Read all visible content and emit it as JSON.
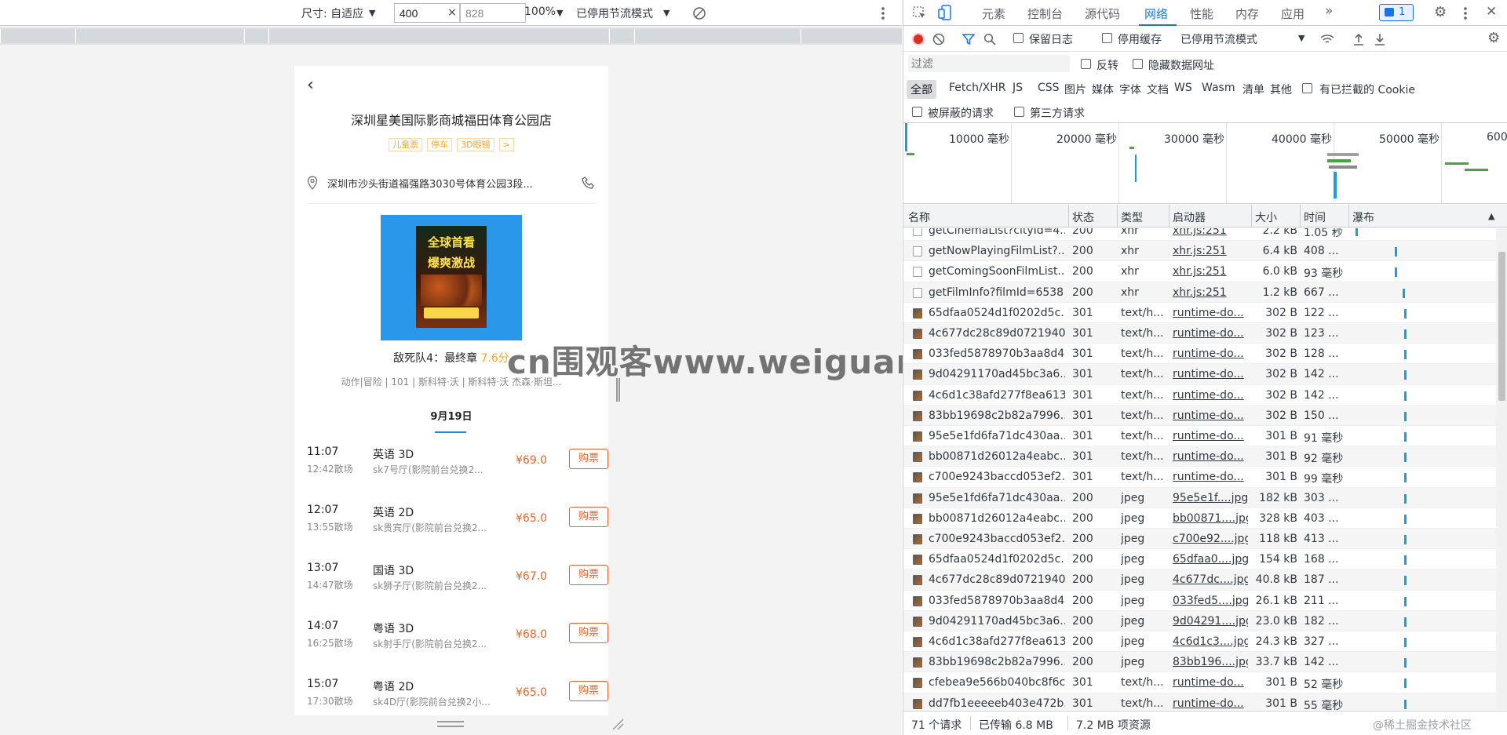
{
  "emulation": {
    "size_label": "尺寸: 自适应",
    "width": "400",
    "height": "828",
    "times": "×",
    "zoom": "100%",
    "throttle": "已停用节流模式"
  },
  "mobile": {
    "cinema_name": "深圳星美国际影商城福田体育公园店",
    "tags": [
      "儿童票",
      "停车",
      "3D眼镜",
      ">"
    ],
    "address": "深圳市沙头街道福强路3030号体育公园3段...",
    "poster_line1": "全球首看",
    "poster_line2": "爆爽激战",
    "film_title": "敌死队4：最终章",
    "film_score": "7.6分",
    "film_info": "动作|冒险 | 101 | 斯科特·沃 | 斯科特·沃 杰森·斯坦...",
    "date_tab": "9月19日",
    "shows": [
      {
        "start": "11:07",
        "end": "12:42散场",
        "lang": "英语 3D",
        "hall": "sk7号厅(影院前台兑换2...",
        "price": "¥69.0",
        "buy": "购票"
      },
      {
        "start": "12:07",
        "end": "13:55散场",
        "lang": "英语 2D",
        "hall": "sk贵宾厅(影院前台兑换2...",
        "price": "¥65.0",
        "buy": "购票"
      },
      {
        "start": "13:07",
        "end": "14:47散场",
        "lang": "国语 3D",
        "hall": "sk狮子厅(影院前台兑换2...",
        "price": "¥67.0",
        "buy": "购票"
      },
      {
        "start": "14:07",
        "end": "16:25散场",
        "lang": "粤语 3D",
        "hall": "sk射手厅(影院前台兑换2...",
        "price": "¥68.0",
        "buy": "购票"
      },
      {
        "start": "15:07",
        "end": "17:30散场",
        "lang": "粤语 2D",
        "hall": "sk4D厅(影院前台兑换2小...",
        "price": "¥65.0",
        "buy": "购票"
      }
    ]
  },
  "watermark": "cn围观客www.weiguanke.cn",
  "devtools": {
    "tabs": [
      "元素",
      "控制台",
      "源代码",
      "网络",
      "性能",
      "内存",
      "应用"
    ],
    "active_tab": "网络",
    "more": "»",
    "issues_badge": "1",
    "toolbar": {
      "preserve_log": "保留日志",
      "disable_cache": "停用缓存",
      "throttle": "已停用节流模式"
    },
    "filter_placeholder": "过滤",
    "invert": "反转",
    "hide_data_urls": "隐藏数据网址",
    "types": [
      "全部",
      "Fetch/XHR",
      "JS",
      "CSS",
      "图片",
      "媒体",
      "字体",
      "文档",
      "WS",
      "Wasm",
      "清单",
      "其他"
    ],
    "blocked_cookies": "有已拦截的 Cookie",
    "blocked_requests": "被屏蔽的请求",
    "third_party": "第三方请求",
    "overview_ticks": [
      "10000 毫秒",
      "20000 毫秒",
      "30000 毫秒",
      "40000 毫秒",
      "50000 毫秒",
      "600"
    ],
    "columns": [
      "名称",
      "状态",
      "类型",
      "启动器",
      "大小",
      "时间",
      "瀑布"
    ],
    "rows": [
      {
        "name": "getCinemaList?cityId=4...",
        "status": "200",
        "type": "xhr",
        "init": "xhr.js:251",
        "size": "2.2 kB",
        "time": "1.05 秒",
        "img": false,
        "wf": 2
      },
      {
        "name": "getNowPlayingFilmList?...",
        "status": "200",
        "type": "xhr",
        "init": "xhr.js:251",
        "size": "6.4 kB",
        "time": "408 ...",
        "img": false,
        "wf": 27
      },
      {
        "name": "getComingSoonFilmList...",
        "status": "200",
        "type": "xhr",
        "init": "xhr.js:251",
        "size": "6.0 kB",
        "time": "93 毫秒",
        "img": false,
        "wf": 27
      },
      {
        "name": "getFilmInfo?filmId=6538",
        "status": "200",
        "type": "xhr",
        "init": "xhr.js:251",
        "size": "1.2 kB",
        "time": "667 ...",
        "img": false,
        "wf": 32
      },
      {
        "name": "65dfaa0524d1f0202d5c...",
        "status": "301",
        "type": "text/h...",
        "init": "runtime-do...",
        "size": "302 B",
        "time": "122 ...",
        "img": true,
        "wf": 33
      },
      {
        "name": "4c677dc28c89d0721940...",
        "status": "301",
        "type": "text/h...",
        "init": "runtime-do...",
        "size": "302 B",
        "time": "123 ...",
        "img": true,
        "wf": 33
      },
      {
        "name": "033fed5878970b3aa8d4...",
        "status": "301",
        "type": "text/h...",
        "init": "runtime-do...",
        "size": "302 B",
        "time": "128 ...",
        "img": true,
        "wf": 33
      },
      {
        "name": "9d04291170ad45bc3a6...",
        "status": "301",
        "type": "text/h...",
        "init": "runtime-do...",
        "size": "302 B",
        "time": "142 ...",
        "img": true,
        "wf": 33
      },
      {
        "name": "4c6d1c38afd277f8ea613...",
        "status": "301",
        "type": "text/h...",
        "init": "runtime-do...",
        "size": "302 B",
        "time": "142 ...",
        "img": true,
        "wf": 33
      },
      {
        "name": "83bb19698c2b82a7996...",
        "status": "301",
        "type": "text/h...",
        "init": "runtime-do...",
        "size": "302 B",
        "time": "150 ...",
        "img": true,
        "wf": 33
      },
      {
        "name": "95e5e1fd6fa71dc430aa...",
        "status": "301",
        "type": "text/h...",
        "init": "runtime-do...",
        "size": "301 B",
        "time": "91 毫秒",
        "img": true,
        "wf": 33
      },
      {
        "name": "bb00871d26012a4eabc...",
        "status": "301",
        "type": "text/h...",
        "init": "runtime-do...",
        "size": "301 B",
        "time": "92 毫秒",
        "img": true,
        "wf": 33
      },
      {
        "name": "c700e9243baccd053ef2...",
        "status": "301",
        "type": "text/h...",
        "init": "runtime-do...",
        "size": "301 B",
        "time": "99 毫秒",
        "img": true,
        "wf": 33
      },
      {
        "name": "95e5e1fd6fa71dc430aa...",
        "status": "200",
        "type": "jpeg",
        "init": "95e5e1f....jpg",
        "size": "182 kB",
        "time": "303 ...",
        "img": true,
        "wf": 33
      },
      {
        "name": "bb00871d26012a4eabc...",
        "status": "200",
        "type": "jpeg",
        "init": "bb00871....jpg",
        "size": "328 kB",
        "time": "403 ...",
        "img": true,
        "wf": 33
      },
      {
        "name": "c700e9243baccd053ef2...",
        "status": "200",
        "type": "jpeg",
        "init": "c700e92....jpg",
        "size": "118 kB",
        "time": "413 ...",
        "img": true,
        "wf": 33
      },
      {
        "name": "65dfaa0524d1f0202d5c...",
        "status": "200",
        "type": "jpeg",
        "init": "65dfaa0....jpg",
        "size": "154 kB",
        "time": "168 ...",
        "img": true,
        "wf": 33
      },
      {
        "name": "4c677dc28c89d0721940...",
        "status": "200",
        "type": "jpeg",
        "init": "4c677dc....jpg",
        "size": "40.8 kB",
        "time": "187 ...",
        "img": true,
        "wf": 33
      },
      {
        "name": "033fed5878970b3aa8d4...",
        "status": "200",
        "type": "jpeg",
        "init": "033fed5....jpg",
        "size": "26.1 kB",
        "time": "211 ...",
        "img": true,
        "wf": 33
      },
      {
        "name": "9d04291170ad45bc3a6...",
        "status": "200",
        "type": "jpeg",
        "init": "9d04291....jpg",
        "size": "23.0 kB",
        "time": "182 ...",
        "img": true,
        "wf": 33
      },
      {
        "name": "4c6d1c38afd277f8ea613...",
        "status": "200",
        "type": "jpeg",
        "init": "4c6d1c3....jpg",
        "size": "24.3 kB",
        "time": "327 ...",
        "img": true,
        "wf": 33
      },
      {
        "name": "83bb19698c2b82a7996...",
        "status": "200",
        "type": "jpeg",
        "init": "83bb196....jpg",
        "size": "33.7 kB",
        "time": "142 ...",
        "img": true,
        "wf": 33
      },
      {
        "name": "cfebea9e566b040bc8f6c...",
        "status": "301",
        "type": "text/h...",
        "init": "runtime-do...",
        "size": "301 B",
        "time": "52 毫秒",
        "img": true,
        "wf": 33
      },
      {
        "name": "dd7fb1eeeeeb403e472b...",
        "status": "301",
        "type": "text/h...",
        "init": "runtime-do...",
        "size": "301 B",
        "time": "55 毫秒",
        "img": true,
        "wf": 33
      }
    ],
    "status_bar": {
      "requests": "71 个请求",
      "transferred": "已传输 6.8 MB",
      "resources": "7.2 MB 项资源",
      "credit": "@稀土掘金技术社区"
    }
  },
  "colors": {
    "accent": "#1a73e8",
    "price": "#e8632b",
    "tag": "#f5a623",
    "record": "#d93025"
  }
}
